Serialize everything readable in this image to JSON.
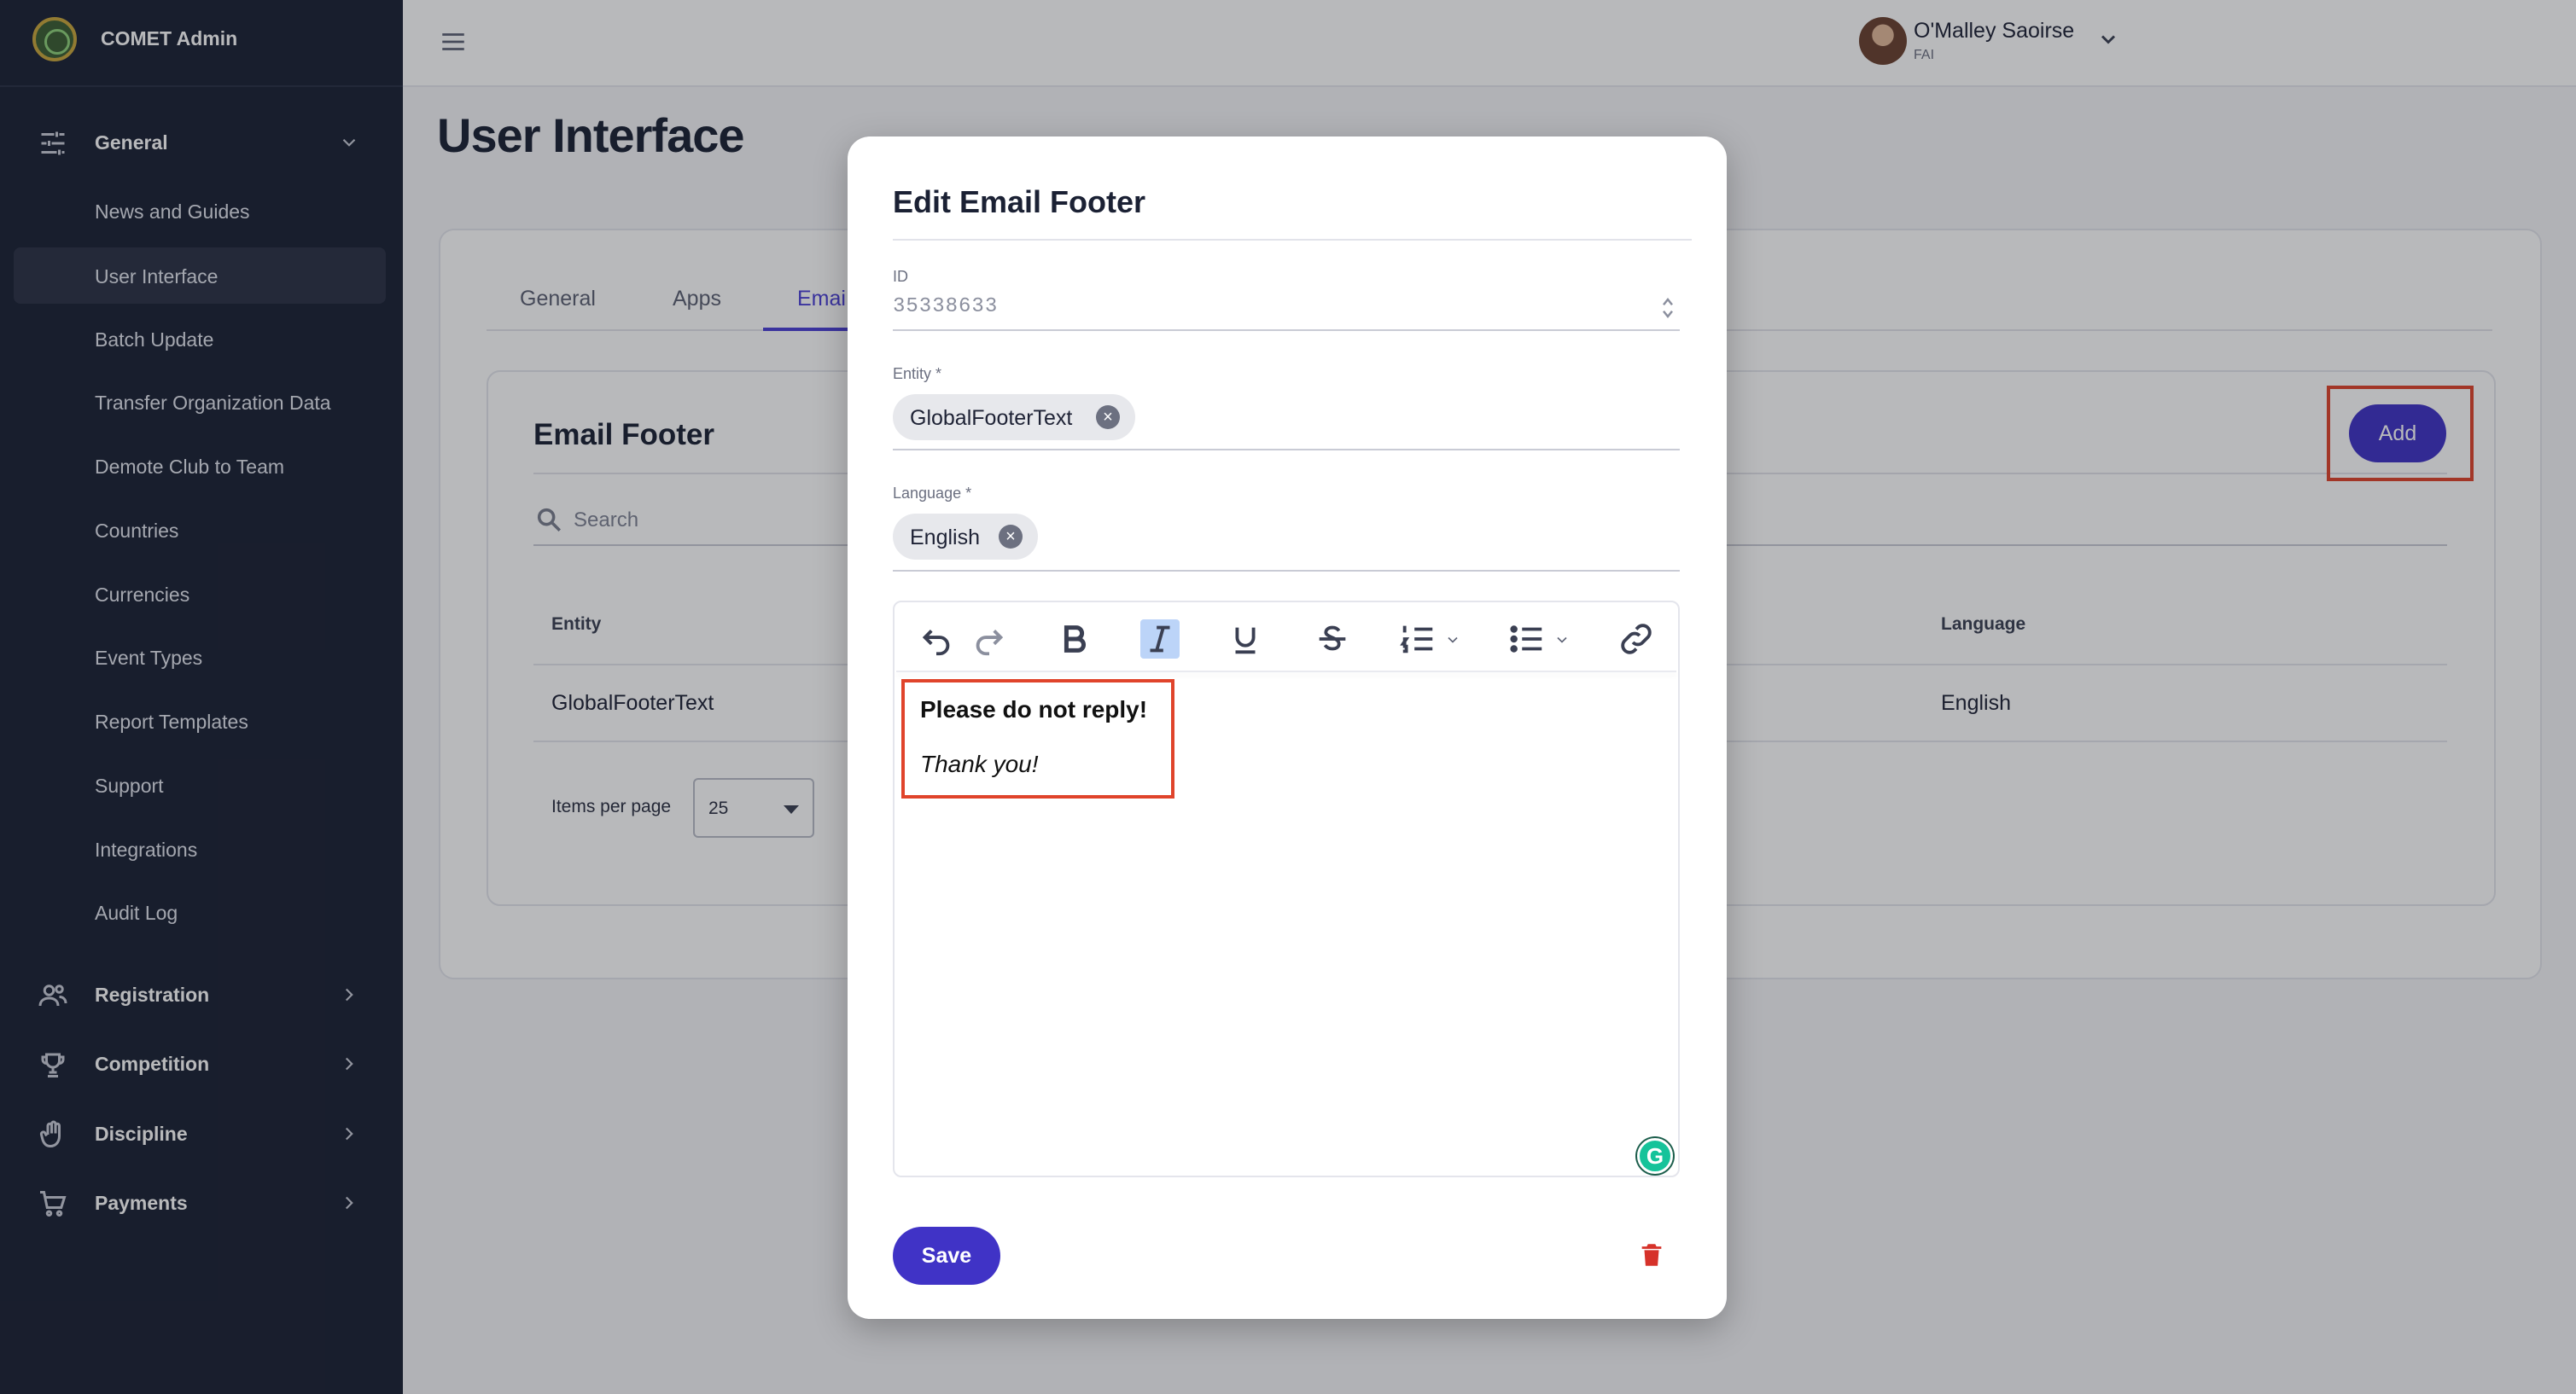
{
  "app": {
    "name": "COMET Admin",
    "logo_icon": "comet-logo-icon"
  },
  "sidebar": {
    "groups": [
      {
        "label": "General",
        "icon": "sliders-icon",
        "expanded": true
      },
      {
        "label": "Registration",
        "icon": "users-icon",
        "expanded": false
      },
      {
        "label": "Competition",
        "icon": "trophy-icon",
        "expanded": false
      },
      {
        "label": "Discipline",
        "icon": "hand-icon",
        "expanded": false
      },
      {
        "label": "Payments",
        "icon": "cart-icon",
        "expanded": false
      }
    ],
    "items": [
      {
        "label": "News and Guides",
        "active": false
      },
      {
        "label": "User Interface",
        "active": true
      },
      {
        "label": "Batch Update",
        "active": false
      },
      {
        "label": "Transfer Organization Data",
        "active": false
      },
      {
        "label": "Demote Club to Team",
        "active": false
      },
      {
        "label": "Countries",
        "active": false
      },
      {
        "label": "Currencies",
        "active": false
      },
      {
        "label": "Event Types",
        "active": false
      },
      {
        "label": "Report Templates",
        "active": false
      },
      {
        "label": "Support",
        "active": false
      },
      {
        "label": "Integrations",
        "active": false
      },
      {
        "label": "Audit Log",
        "active": false
      }
    ]
  },
  "header": {
    "user_name": "O'Malley Saoirse",
    "user_org": "FAI"
  },
  "page": {
    "title": "User Interface",
    "tabs": [
      {
        "label": "General",
        "active": false
      },
      {
        "label": "Apps",
        "active": false
      },
      {
        "label": "Emai",
        "active": true
      }
    ]
  },
  "email_footer": {
    "title": "Email Footer",
    "add_label": "Add",
    "search_placeholder": "Search",
    "columns": [
      "Entity",
      "Language"
    ],
    "rows": [
      {
        "entity": "GlobalFooterText",
        "language": "English"
      }
    ],
    "items_per_page_label": "Items per page",
    "items_per_page_value": "25"
  },
  "modal": {
    "title": "Edit Email Footer",
    "id_label": "ID",
    "id_value": "35338633",
    "entity_label": "Entity *",
    "entity_chip": "GlobalFooterText",
    "language_label": "Language *",
    "language_chip": "English",
    "toolbar": [
      "undo-icon",
      "redo-icon",
      "bold-icon",
      "italic-icon",
      "underline-icon",
      "strikethrough-icon",
      "ordered-list-icon",
      "bullet-list-icon",
      "link-icon"
    ],
    "toolbar_active": "italic-icon",
    "content_line1": "Please do not reply!",
    "content_line2": "Thank you!",
    "grammarly_letter": "G",
    "save_label": "Save"
  },
  "colors": {
    "sidebar_bg": "#1b2134",
    "primary": "#4033c6",
    "highlight": "#e0442b",
    "danger": "#d6322a"
  }
}
